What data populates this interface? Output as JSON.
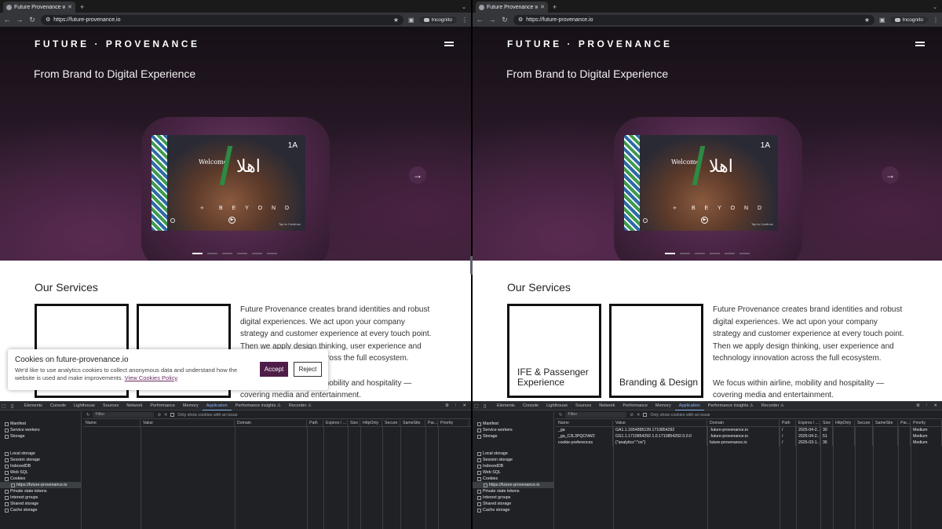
{
  "browser": {
    "tab_title": "Future Provenance works wit",
    "tab_close": "✕",
    "new_tab": "+",
    "tab_menu": "⌄",
    "url": "https://future-provenance.io",
    "incognito_label": "Incognito"
  },
  "site": {
    "brand": "FUTURE · PROVENANCE",
    "tagline": "From Brand to Digital Experience",
    "screen": {
      "welcome": "Welcome",
      "arabic": "اهلا",
      "seat": "1A",
      "beyond": "B E Y O Ν D",
      "tap": "Tap to Continue"
    },
    "services_title": "Our Services",
    "cards_left": [
      "",
      ""
    ],
    "cards_right": [
      "IFE & Passenger Experience",
      "Branding & Design"
    ],
    "description": [
      "Future Provenance creates brand identities and robust digital experiences. We act upon your company strategy and customer experience at every touch point. Then we apply design thinking, user experience and technology innovation across the full ecosystem.",
      "We focus within airline, mobility and hospitality — covering media and entertainment."
    ]
  },
  "cookie_banner": {
    "title": "Cookies on future-provenance.io",
    "text": "We'd like to use analytics cookies to collect anonymous data and understand how the website is used and make improvements.",
    "link": "View Cookies Policy",
    "link_suffix": ".",
    "accept": "Accept",
    "reject": "Reject"
  },
  "devtools": {
    "tabs": [
      "Elements",
      "Console",
      "Lighthouse",
      "Sources",
      "Network",
      "Performance",
      "Memory",
      "Application",
      "Performance insights ⚠",
      "Recorder ⚠"
    ],
    "active_tab": "Application",
    "filter_placeholder": "Filter",
    "only_issue_label": "Only show cookies with an issue",
    "sidebar_top": [
      "Manifest",
      "Service workers",
      "Storage"
    ],
    "sidebar_storage": [
      "Local storage",
      "Session storage",
      "IndexedDB",
      "Web SQL",
      "Cookies"
    ],
    "cookie_origin": "https://future-provenance.io",
    "sidebar_bottom": [
      "Private state tokens",
      "Interest groups",
      "Shared storage",
      "Cache storage"
    ],
    "columns": [
      "Name",
      "Value",
      "Domain",
      "Path",
      "Expires / ...",
      "Size",
      "HttpOnly",
      "Secure",
      "SameSite",
      "Par...",
      "Priority"
    ],
    "rows_right": [
      [
        "_ga",
        "GA1.1.1654895139.1710854292",
        ".future-provenance.io",
        "/",
        "2025-04-2...",
        "30",
        "",
        "",
        "",
        "",
        "Medium"
      ],
      [
        "_ga_C3L3PQCNW2",
        "GS1.1.1710854292.1.0.1710854292.0.0.0",
        ".future-provenance.io",
        "/",
        "2025-04-2...",
        "51",
        "",
        "",
        "",
        "",
        "Medium"
      ],
      [
        "cookie-preferences",
        "{\"analytics\":\"on\"}",
        "future-provenance.io",
        "/",
        "2025-03-1...",
        "36",
        "",
        "",
        "",
        "",
        "Medium"
      ]
    ]
  },
  "colors": {
    "accent": "#4e1e49",
    "devtools_bg": "#202124",
    "link": "#6a2b62"
  }
}
